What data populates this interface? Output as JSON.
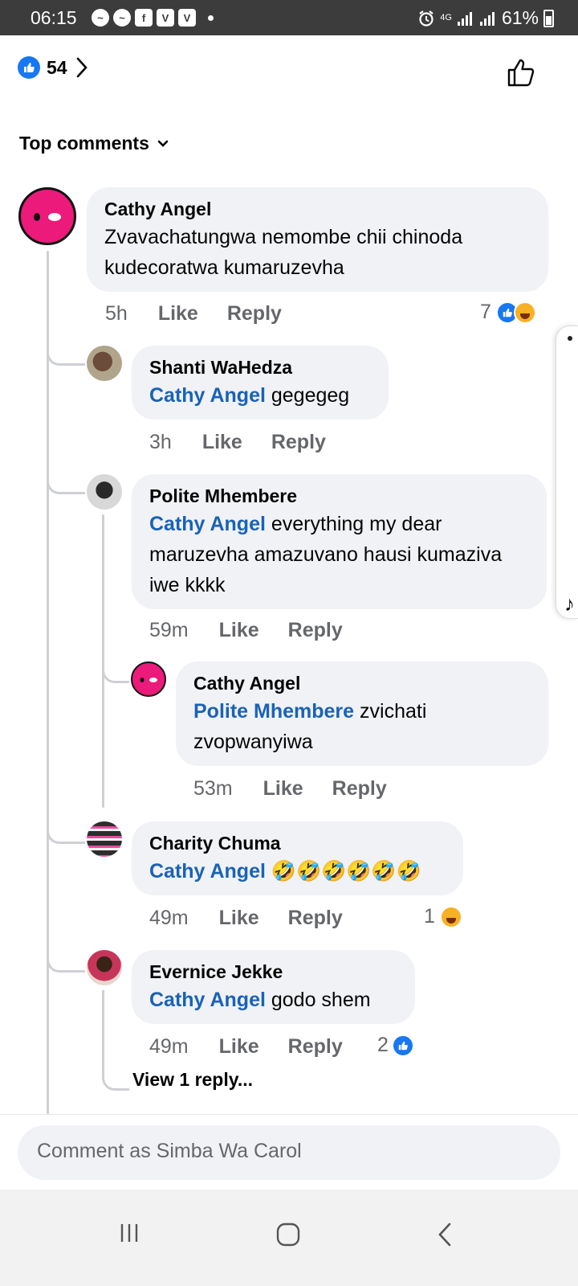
{
  "status_bar": {
    "time": "06:15",
    "network": "4G",
    "battery": "61%"
  },
  "header": {
    "reaction_count": "54",
    "sort_label": "Top comments"
  },
  "comments": [
    {
      "name": "Cathy Angel",
      "text": "Zvavachatungwa nemombe chii chinoda kudecoratwa kumaruzevha",
      "time": "5h",
      "like": "Like",
      "reply": "Reply",
      "reaction_count": "7"
    },
    {
      "name": "Shanti WaHedza",
      "mention": "Cathy Angel",
      "text": " gegegeg",
      "time": "3h",
      "like": "Like",
      "reply": "Reply"
    },
    {
      "name": "Polite Mhembere",
      "mention": "Cathy Angel",
      "text": " everything my dear maruzevha amazuvano hausi kumaziva iwe kkkk",
      "time": "59m",
      "like": "Like",
      "reply": "Reply"
    },
    {
      "name": "Cathy Angel",
      "mention": "Polite Mhembere",
      "text": " zvichati zvopwanyiwa",
      "time": "53m",
      "like": "Like",
      "reply": "Reply"
    },
    {
      "name": "Charity Chuma",
      "mention": "Cathy Angel",
      "text": " 🤣🤣🤣🤣🤣🤣",
      "time": "49m",
      "like": "Like",
      "reply": "Reply",
      "reaction_count": "1"
    },
    {
      "name": "Evernice Jekke",
      "mention": "Cathy Angel",
      "text": " godo shem",
      "time": "49m",
      "like": "Like",
      "reply": "Reply",
      "reaction_count": "2"
    }
  ],
  "view_replies": "View 1 reply...",
  "composer": {
    "placeholder": "Comment as Simba Wa Carol"
  },
  "colors": {
    "accent": "#1877f2",
    "mention": "#1a62b6",
    "bubble": "#f0f2f5",
    "avatar_pink": "#ec1a7a"
  }
}
